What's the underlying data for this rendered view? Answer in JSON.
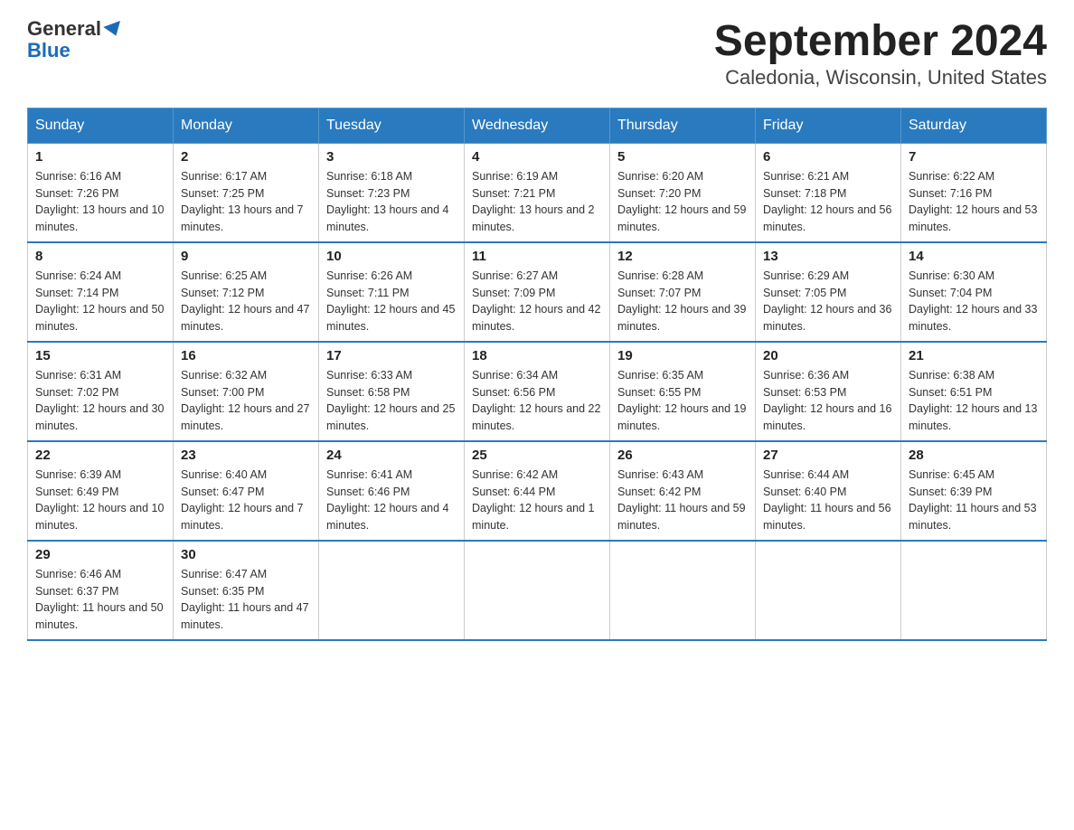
{
  "logo": {
    "line1": "General",
    "line2": "Blue"
  },
  "title": "September 2024",
  "subtitle": "Caledonia, Wisconsin, United States",
  "weekdays": [
    "Sunday",
    "Monday",
    "Tuesday",
    "Wednesday",
    "Thursday",
    "Friday",
    "Saturday"
  ],
  "weeks": [
    [
      {
        "day": "1",
        "sunrise": "6:16 AM",
        "sunset": "7:26 PM",
        "daylight": "13 hours and 10 minutes."
      },
      {
        "day": "2",
        "sunrise": "6:17 AM",
        "sunset": "7:25 PM",
        "daylight": "13 hours and 7 minutes."
      },
      {
        "day": "3",
        "sunrise": "6:18 AM",
        "sunset": "7:23 PM",
        "daylight": "13 hours and 4 minutes."
      },
      {
        "day": "4",
        "sunrise": "6:19 AM",
        "sunset": "7:21 PM",
        "daylight": "13 hours and 2 minutes."
      },
      {
        "day": "5",
        "sunrise": "6:20 AM",
        "sunset": "7:20 PM",
        "daylight": "12 hours and 59 minutes."
      },
      {
        "day": "6",
        "sunrise": "6:21 AM",
        "sunset": "7:18 PM",
        "daylight": "12 hours and 56 minutes."
      },
      {
        "day": "7",
        "sunrise": "6:22 AM",
        "sunset": "7:16 PM",
        "daylight": "12 hours and 53 minutes."
      }
    ],
    [
      {
        "day": "8",
        "sunrise": "6:24 AM",
        "sunset": "7:14 PM",
        "daylight": "12 hours and 50 minutes."
      },
      {
        "day": "9",
        "sunrise": "6:25 AM",
        "sunset": "7:12 PM",
        "daylight": "12 hours and 47 minutes."
      },
      {
        "day": "10",
        "sunrise": "6:26 AM",
        "sunset": "7:11 PM",
        "daylight": "12 hours and 45 minutes."
      },
      {
        "day": "11",
        "sunrise": "6:27 AM",
        "sunset": "7:09 PM",
        "daylight": "12 hours and 42 minutes."
      },
      {
        "day": "12",
        "sunrise": "6:28 AM",
        "sunset": "7:07 PM",
        "daylight": "12 hours and 39 minutes."
      },
      {
        "day": "13",
        "sunrise": "6:29 AM",
        "sunset": "7:05 PM",
        "daylight": "12 hours and 36 minutes."
      },
      {
        "day": "14",
        "sunrise": "6:30 AM",
        "sunset": "7:04 PM",
        "daylight": "12 hours and 33 minutes."
      }
    ],
    [
      {
        "day": "15",
        "sunrise": "6:31 AM",
        "sunset": "7:02 PM",
        "daylight": "12 hours and 30 minutes."
      },
      {
        "day": "16",
        "sunrise": "6:32 AM",
        "sunset": "7:00 PM",
        "daylight": "12 hours and 27 minutes."
      },
      {
        "day": "17",
        "sunrise": "6:33 AM",
        "sunset": "6:58 PM",
        "daylight": "12 hours and 25 minutes."
      },
      {
        "day": "18",
        "sunrise": "6:34 AM",
        "sunset": "6:56 PM",
        "daylight": "12 hours and 22 minutes."
      },
      {
        "day": "19",
        "sunrise": "6:35 AM",
        "sunset": "6:55 PM",
        "daylight": "12 hours and 19 minutes."
      },
      {
        "day": "20",
        "sunrise": "6:36 AM",
        "sunset": "6:53 PM",
        "daylight": "12 hours and 16 minutes."
      },
      {
        "day": "21",
        "sunrise": "6:38 AM",
        "sunset": "6:51 PM",
        "daylight": "12 hours and 13 minutes."
      }
    ],
    [
      {
        "day": "22",
        "sunrise": "6:39 AM",
        "sunset": "6:49 PM",
        "daylight": "12 hours and 10 minutes."
      },
      {
        "day": "23",
        "sunrise": "6:40 AM",
        "sunset": "6:47 PM",
        "daylight": "12 hours and 7 minutes."
      },
      {
        "day": "24",
        "sunrise": "6:41 AM",
        "sunset": "6:46 PM",
        "daylight": "12 hours and 4 minutes."
      },
      {
        "day": "25",
        "sunrise": "6:42 AM",
        "sunset": "6:44 PM",
        "daylight": "12 hours and 1 minute."
      },
      {
        "day": "26",
        "sunrise": "6:43 AM",
        "sunset": "6:42 PM",
        "daylight": "11 hours and 59 minutes."
      },
      {
        "day": "27",
        "sunrise": "6:44 AM",
        "sunset": "6:40 PM",
        "daylight": "11 hours and 56 minutes."
      },
      {
        "day": "28",
        "sunrise": "6:45 AM",
        "sunset": "6:39 PM",
        "daylight": "11 hours and 53 minutes."
      }
    ],
    [
      {
        "day": "29",
        "sunrise": "6:46 AM",
        "sunset": "6:37 PM",
        "daylight": "11 hours and 50 minutes."
      },
      {
        "day": "30",
        "sunrise": "6:47 AM",
        "sunset": "6:35 PM",
        "daylight": "11 hours and 47 minutes."
      },
      null,
      null,
      null,
      null,
      null
    ]
  ]
}
